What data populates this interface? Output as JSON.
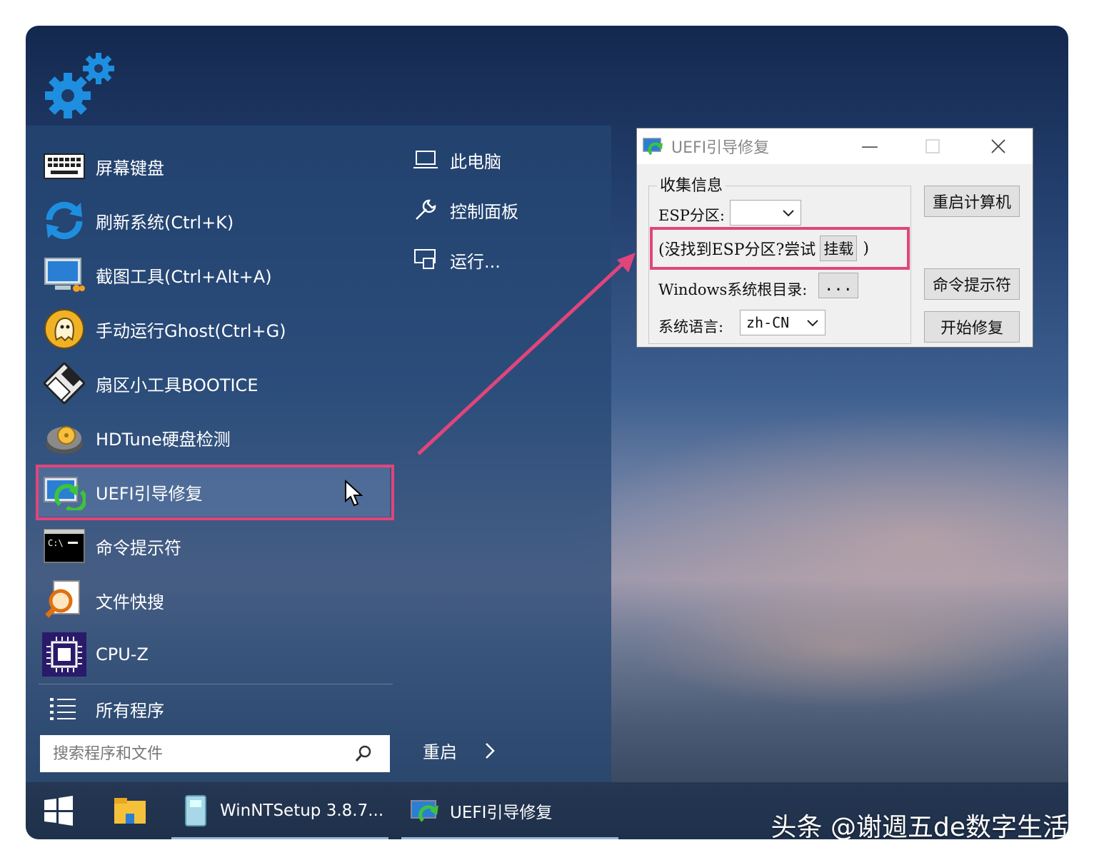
{
  "start_menu": {
    "items": [
      {
        "label": "屏幕键盘",
        "icon": "keyboard-icon"
      },
      {
        "label": "刷新系统(Ctrl+K)",
        "icon": "refresh-icon"
      },
      {
        "label": "截图工具(Ctrl+Alt+A)",
        "icon": "screenshot-icon"
      },
      {
        "label": "手动运行Ghost(Ctrl+G)",
        "icon": "ghost-icon"
      },
      {
        "label": "扇区小工具BOOTICE",
        "icon": "disk-icon"
      },
      {
        "label": "HDTune硬盘检测",
        "icon": "hdtune-icon"
      },
      {
        "label": "UEFI引导修复",
        "icon": "uefi-repair-icon"
      },
      {
        "label": "命令提示符",
        "icon": "cmd-icon"
      },
      {
        "label": "文件快搜",
        "icon": "file-search-icon"
      },
      {
        "label": "CPU-Z",
        "icon": "cpu-icon"
      },
      {
        "label": "所有程序",
        "icon": "list-icon"
      }
    ],
    "right_items": [
      {
        "label": "此电脑",
        "icon": "computer-icon"
      },
      {
        "label": "控制面板",
        "icon": "wrench-icon"
      },
      {
        "label": "运行...",
        "icon": "run-icon"
      }
    ],
    "search_placeholder": "搜索程序和文件",
    "restart_label": "重启"
  },
  "taskbar": {
    "items": [
      {
        "label": "WinNTSetup 3.8.7..."
      },
      {
        "label": "UEFI引导修复"
      }
    ]
  },
  "dialog": {
    "title": "UEFI引导修复",
    "group_title": "收集信息",
    "esp_label": "ESP分区:",
    "esp_value": "",
    "esp_notice_prefix": "(没找到ESP分区?尝试",
    "esp_mount_label": "挂载",
    "esp_notice_suffix": ")",
    "windows_root_label": "Windows系统根目录:",
    "browse_label": "...",
    "language_label": "系统语言:",
    "language_value": "zh-CN",
    "restart_button": "重启计算机",
    "cmd_button": "命令提示符",
    "repair_button": "开始修复"
  },
  "watermark": "头条 @谢週五de数字生活",
  "colors": {
    "highlight": "#e0457b",
    "accent_icon": "#1e8fe0"
  }
}
